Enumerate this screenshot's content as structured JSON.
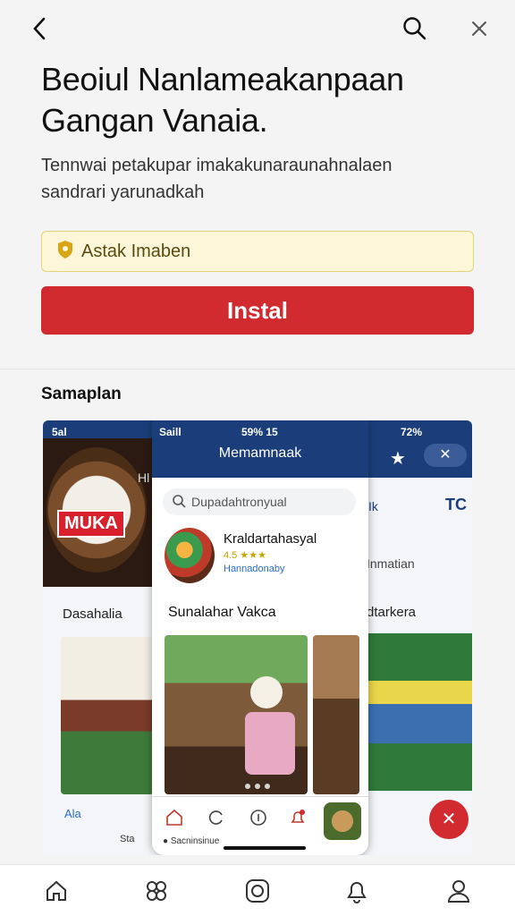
{
  "header": {
    "back_icon": "chevron-left-icon",
    "search_icon": "search-icon",
    "close_icon": "close-icon"
  },
  "app": {
    "title_line1": "Beoiul Nanlameakanpaan",
    "title_line2": "Gangan Vanaia.",
    "subtitle_line1": "Tennwai petakupar imakakunaraunahnalaen",
    "subtitle_line2": "sandrari yarunadkah",
    "chip_label": "Astak Imaben",
    "install_label": "Instal"
  },
  "screenshots": {
    "section_label": "Samaplan",
    "left": {
      "logo_text": "MUKA",
      "status": "5al",
      "label": "Dasahalia",
      "partial_header": "Hl",
      "bottom_label_1": "Ala",
      "bottom_label_2": "Sta"
    },
    "center": {
      "status_left": "Saill",
      "status_mid": "59% 15",
      "header_title": "Memamnaak",
      "search_placeholder": "Dupadahtronyual",
      "product_name": "Kraldartahasyal",
      "product_rating": "4.5 ★★★",
      "product_developer": "Hannadonaby",
      "section_title": "Sunalahar Vakca",
      "tab_caption": "Sacninsinue"
    },
    "right": {
      "status": "72%",
      "label": "dtarkera",
      "side_text": "Inmatian",
      "ik": "Ik",
      "tc": "TC"
    }
  },
  "bottom_nav": [
    {
      "icon": "home-icon"
    },
    {
      "icon": "apps-icon"
    },
    {
      "icon": "camera-icon"
    },
    {
      "icon": "notifications-icon"
    },
    {
      "icon": "profile-icon"
    }
  ],
  "colors": {
    "accent_red": "#d12a2f",
    "navy": "#1b3e7a",
    "chip_bg": "#fdf6d8"
  }
}
